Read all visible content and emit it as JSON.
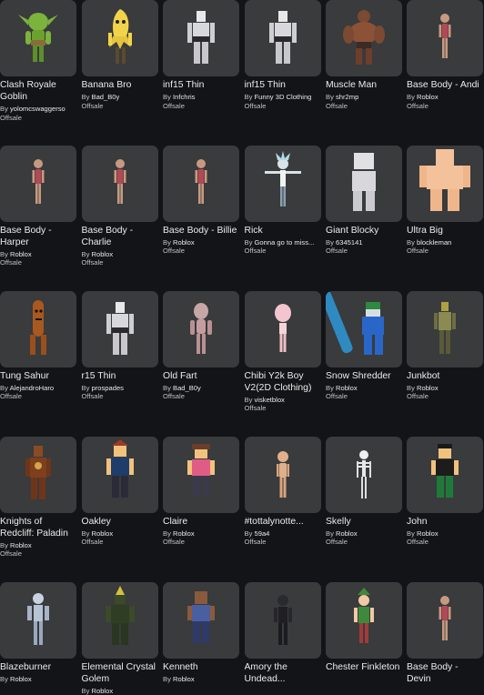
{
  "by_prefix": "By",
  "items": [
    {
      "name": "Clash Royale Goblin",
      "creator": "yolomcswaggerso",
      "price": "Offsale",
      "icon": "goblin-avatar-icon"
    },
    {
      "name": "Banana Bro",
      "creator": "Bad_B0y",
      "price": "Offsale",
      "icon": "banana-avatar-icon"
    },
    {
      "name": "inf15 Thin",
      "creator": "Infchris",
      "price": "Offsale",
      "icon": "thin-block-avatar-icon"
    },
    {
      "name": "inf15 Thin",
      "creator": "Funny 3D Clothing",
      "price": "Offsale",
      "icon": "thin-block-avatar-icon"
    },
    {
      "name": "Muscle Man",
      "creator": "shr2mp",
      "price": "Offsale",
      "icon": "muscle-man-avatar-icon"
    },
    {
      "name": "Base Body - Andi",
      "creator": "Roblox",
      "price": "Offsale",
      "icon": "base-body-avatar-icon"
    },
    {
      "name": "Base Body - Harper",
      "creator": "Roblox",
      "price": "Offsale",
      "icon": "base-body-avatar-icon"
    },
    {
      "name": "Base Body - Charlie",
      "creator": "Roblox",
      "price": "Offsale",
      "icon": "base-body-avatar-icon"
    },
    {
      "name": "Base Body - Billie",
      "creator": "Roblox",
      "price": "Offsale",
      "icon": "base-body-avatar-icon"
    },
    {
      "name": "Rick",
      "creator": "Gonna go to miss...",
      "price": "Offsale",
      "icon": "rick-avatar-icon"
    },
    {
      "name": "Giant Blocky",
      "creator": "6345141",
      "price": "Offsale",
      "icon": "giant-blocky-avatar-icon"
    },
    {
      "name": "Ultra Big",
      "creator": "blockleman",
      "price": "Offsale",
      "icon": "ultra-big-avatar-icon"
    },
    {
      "name": "Tung Sahur",
      "creator": "AlejandroHaro",
      "price": "Offsale",
      "icon": "tung-sahur-avatar-icon"
    },
    {
      "name": "r15 Thin",
      "creator": "prospades",
      "price": "Offsale",
      "icon": "thin-block-avatar-icon"
    },
    {
      "name": "Old Fart",
      "creator": "Bad_B0y",
      "price": "Offsale",
      "icon": "old-fart-avatar-icon"
    },
    {
      "name": "Chibi Y2k Boy V2(2D Clothing)",
      "creator": "visketblox",
      "price": "Offsale",
      "icon": "chibi-avatar-icon"
    },
    {
      "name": "Snow Shredder",
      "creator": "Roblox",
      "price": "Offsale",
      "icon": "snow-shredder-avatar-icon"
    },
    {
      "name": "Junkbot",
      "creator": "Roblox",
      "price": "Offsale",
      "icon": "junkbot-avatar-icon"
    },
    {
      "name": "Knights of Redcliff: Paladin",
      "creator": "Roblox",
      "price": "Offsale",
      "icon": "paladin-avatar-icon"
    },
    {
      "name": "Oakley",
      "creator": "Roblox",
      "price": "Offsale",
      "icon": "oakley-avatar-icon"
    },
    {
      "name": "Claire",
      "creator": "Roblox",
      "price": "Offsale",
      "icon": "claire-avatar-icon"
    },
    {
      "name": "#tottalynotte...",
      "creator": "59a4",
      "price": "Offsale",
      "icon": "skin-avatar-icon"
    },
    {
      "name": "Skelly",
      "creator": "Roblox",
      "price": "Offsale",
      "icon": "skeleton-avatar-icon"
    },
    {
      "name": "John",
      "creator": "Roblox",
      "price": "Offsale",
      "icon": "john-avatar-icon"
    },
    {
      "name": "Blazeburner",
      "creator": "Roblox",
      "price": "",
      "icon": "blazeburner-avatar-icon"
    },
    {
      "name": "Elemental Crystal Golem",
      "creator": "Roblox",
      "price": "",
      "icon": "golem-avatar-icon"
    },
    {
      "name": "Kenneth",
      "creator": "Roblox",
      "price": "",
      "icon": "kenneth-avatar-icon"
    },
    {
      "name": "Amory the Undead...",
      "creator": "",
      "price": "",
      "icon": "undead-avatar-icon"
    },
    {
      "name": "Chester Finkleton",
      "creator": "",
      "price": "",
      "icon": "elf-avatar-icon"
    },
    {
      "name": "Base Body - Devin",
      "creator": "",
      "price": "",
      "icon": "base-body-avatar-icon"
    }
  ]
}
